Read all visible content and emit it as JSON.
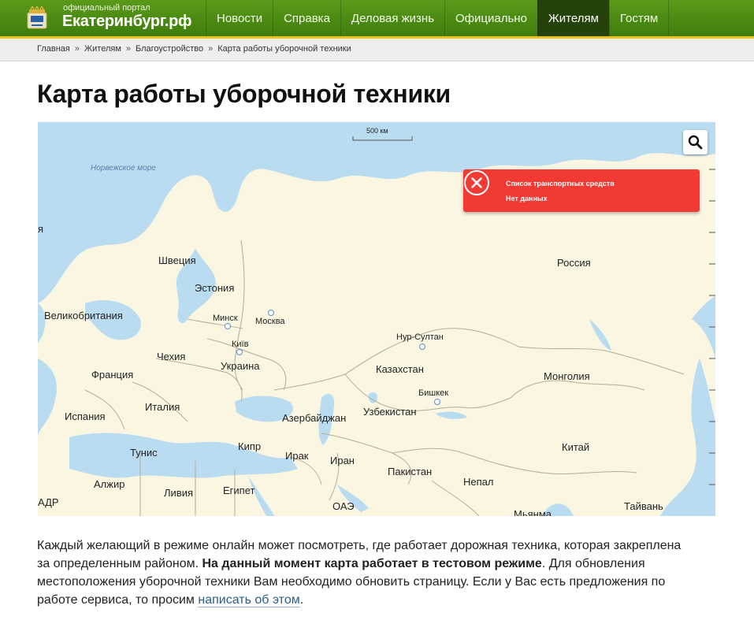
{
  "header": {
    "portal_label": "официальный портал",
    "site_name": "Екатеринбург.рф",
    "nav": [
      "Новости",
      "Справка",
      "Деловая жизнь",
      "Официально",
      "Жителям",
      "Гостям"
    ],
    "active_nav": "Жителям",
    "brand_color": "#3f7d0c",
    "accent_color": "#f0c419"
  },
  "breadcrumb": {
    "items": [
      "Главная",
      "Жителям",
      "Благоустройство",
      "Карта работы уборочной техники"
    ],
    "separator": "»"
  },
  "page_title": "Карта работы уборочной техники",
  "map": {
    "scale_label": "500 км",
    "search_icon": "search-icon",
    "alert": {
      "title": "Список транспортных средств",
      "text": "Нет данных",
      "icon": "close-circle-icon",
      "color": "#f23a34"
    },
    "labels": {
      "norwegian_sea": "Норвежское море",
      "edge_ya": "я",
      "sweden": "Швеция",
      "estonia": "Эстония",
      "russia": "Россия",
      "great_britain": "Великобритания",
      "minsk": "Минск",
      "moscow": "Москва",
      "kyiv": "Київ",
      "ukraine": "Украина",
      "czechia": "Чехия",
      "france": "Франция",
      "spain": "Испания",
      "italy": "Италия",
      "nur_sultan": "Нур-Султан",
      "kazakhstan": "Казахстан",
      "mongolia": "Монголия",
      "bishkek": "Бишкек",
      "uzbekistan": "Узбекистан",
      "azerbaijan": "Азербайджан",
      "tunisia": "Тунис",
      "cyprus": "Кипр",
      "iraq": "Ирак",
      "iran": "Иран",
      "china": "Китай",
      "pakistan": "Пакистан",
      "algeria": "Алжир",
      "libya": "Ливия",
      "egypt": "Египет",
      "nepal": "Непал",
      "sadr": "АДР",
      "uae": "ОАЭ",
      "myanmar": "Мьянма",
      "taiwan": "Тайвань"
    }
  },
  "description": {
    "part1": "Каждый желающий в режиме онлайн может посмотреть, где работает дорожная техника, которая закреплена за определенным районом. ",
    "bold": "На данный момент карта работает в тестовом режиме",
    "part2": ". Для обновления местоположения уборочной техники Вам необходимо обновить страницу. Если у Вас есть предложения по работе сервиса, то просим ",
    "link": "написать об этом",
    "end": "."
  }
}
